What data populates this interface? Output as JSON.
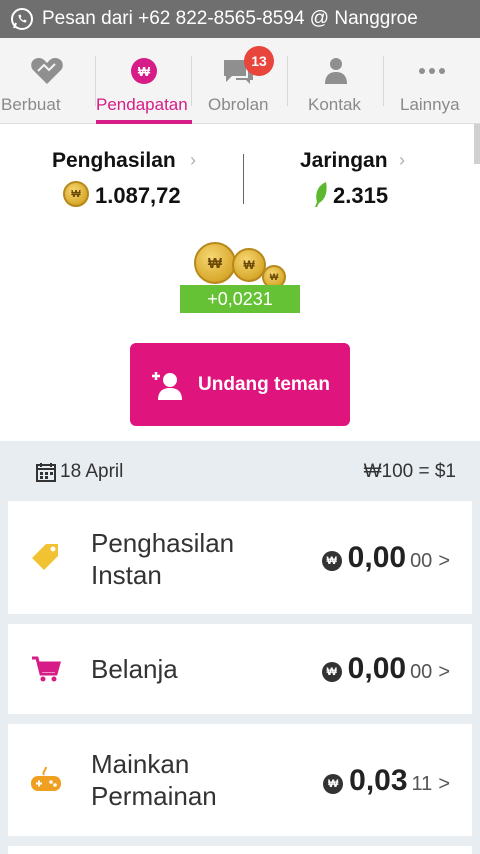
{
  "notification": {
    "text": "Pesan dari +62 822-8565-8594 @ Nanggroe",
    "icon": "whatsapp-icon"
  },
  "tabs": [
    {
      "label": "Berbuat",
      "icon": "heart-icon",
      "active": false
    },
    {
      "label": "Pendapatan",
      "icon": "wcoin-icon",
      "active": true
    },
    {
      "label": "Obrolan",
      "icon": "chat-icon",
      "active": false,
      "badge": "13"
    },
    {
      "label": "Kontak",
      "icon": "person-icon",
      "active": false
    },
    {
      "label": "Lainnya",
      "icon": "more-icon",
      "active": false
    }
  ],
  "earnings": {
    "income_title": "Penghasilan",
    "income_value": "1.087,72",
    "network_title": "Jaringan",
    "network_value": "2.315",
    "gain": "+0,0231",
    "invite_label": "Undang teman"
  },
  "date_row": {
    "date": "18 April",
    "rate": "₩100 = $1"
  },
  "list": [
    {
      "title_line1": "Penghasilan",
      "title_line2": "Instan",
      "amount": "0,00",
      "cents": "00",
      "icon": "tag-icon",
      "color": "#f1c232"
    },
    {
      "title_line1": "Belanja",
      "title_line2": "",
      "amount": "0,00",
      "cents": "00",
      "icon": "cart-icon",
      "color": "#d61c87"
    },
    {
      "title_line1": "Mainkan",
      "title_line2": "Permainan",
      "amount": "0,03",
      "cents": "11",
      "icon": "gamepad-icon",
      "color": "#f0a020"
    }
  ],
  "colors": {
    "accent": "#d61c87",
    "button": "#e0147d",
    "gain": "#65c234",
    "coin": "#e0b13a"
  }
}
